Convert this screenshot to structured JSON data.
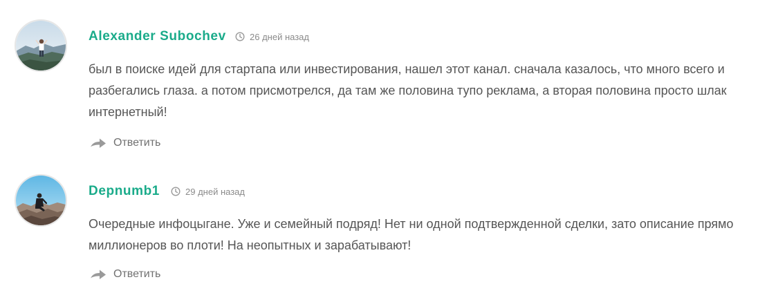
{
  "comments": [
    {
      "author": "Alexander Subochev",
      "time": "26 дней назад",
      "text": "был в поиске идей для стартапа или инвестирования, нашел этот канал. сначала казалось, что много всего и разбегались глаза. а потом присмотрелся, да там же половина тупо реклама, а вторая половина просто шлак интернетный!",
      "reply_label": "Ответить",
      "avatar_icon": "person-on-mountain-photo",
      "icons": {
        "time": "clock-icon",
        "reply": "reply-arrow-icon"
      }
    },
    {
      "author": "Depnumb1",
      "time": "29 дней назад",
      "text": "Очередные инфоцыгане. Уже и семейный подряд! Нет ни одной подтвержденной сделки, зато описание прямо миллионеров во плоти! На неопытных и зарабатывают!",
      "reply_label": "Ответить",
      "avatar_icon": "person-sitting-on-rocks-photo",
      "icons": {
        "time": "clock-icon",
        "reply": "reply-arrow-icon"
      }
    }
  ],
  "colors": {
    "author": "#1aab8a",
    "body_text": "#555555",
    "meta_text": "#8a8a8a",
    "reply_icon": "#9a9a9a"
  }
}
